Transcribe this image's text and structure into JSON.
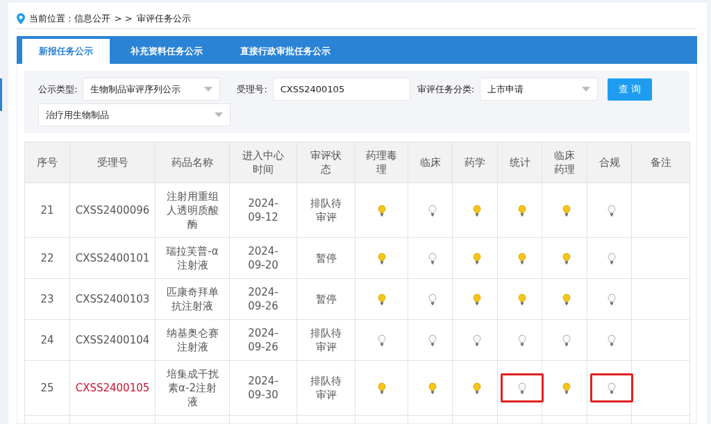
{
  "breadcrumb": {
    "label": "当前位置 : 信息公开",
    "separator": "> >",
    "current": "审评任务公示"
  },
  "tabs": [
    {
      "label": "新报任务公示",
      "selected": true
    },
    {
      "label": "补充资料任务公示",
      "selected": false
    },
    {
      "label": "直接行政审批任务公示",
      "selected": false
    }
  ],
  "filters": {
    "type_label": "公示类型:",
    "type_value": "生物制品审评序列公示",
    "subtype_value": "治疗用生物制品",
    "number_label": "受理号:",
    "number_value": "CXSS2400105",
    "category_label": "审评任务分类:",
    "category_value": "上市申请",
    "query_button": "查 询"
  },
  "table": {
    "columns": [
      "序号",
      "受理号",
      "药品名称",
      "进入中心时间",
      "审评状态",
      "药理毒理",
      "临床",
      "药学",
      "统计",
      "临床药理",
      "合规",
      "备注"
    ],
    "rows": [
      {
        "index": "21",
        "number": "CXSS2400096",
        "drug": "注射用重组人透明质酸酶",
        "date": "2024-09-12",
        "status": "排队待审评",
        "highlighted": false,
        "lamps": [
          {
            "lit": true,
            "highlighted": false
          },
          {
            "lit": false,
            "highlighted": false
          },
          {
            "lit": true,
            "highlighted": false
          },
          {
            "lit": true,
            "highlighted": false
          },
          {
            "lit": true,
            "highlighted": false
          },
          {
            "lit": false,
            "highlighted": false
          }
        ]
      },
      {
        "index": "22",
        "number": "CXSS2400101",
        "drug": "瑞拉芙普-α注射液",
        "date": "2024-09-20",
        "status": "暂停",
        "highlighted": false,
        "lamps": [
          {
            "lit": true,
            "highlighted": false
          },
          {
            "lit": false,
            "highlighted": false
          },
          {
            "lit": true,
            "highlighted": false
          },
          {
            "lit": true,
            "highlighted": false
          },
          {
            "lit": true,
            "highlighted": false
          },
          {
            "lit": false,
            "highlighted": false
          }
        ]
      },
      {
        "index": "23",
        "number": "CXSS2400103",
        "drug": "匹康奇拜单抗注射液",
        "date": "2024-09-26",
        "status": "暂停",
        "highlighted": false,
        "lamps": [
          {
            "lit": true,
            "highlighted": false
          },
          {
            "lit": false,
            "highlighted": false
          },
          {
            "lit": true,
            "highlighted": false
          },
          {
            "lit": true,
            "highlighted": false
          },
          {
            "lit": true,
            "highlighted": false
          },
          {
            "lit": false,
            "highlighted": false
          }
        ]
      },
      {
        "index": "24",
        "number": "CXSS2400104",
        "drug": "纳基奥仑赛注射液",
        "date": "2024-09-26",
        "status": "排队待审评",
        "highlighted": false,
        "lamps": [
          {
            "lit": false,
            "highlighted": false
          },
          {
            "lit": false,
            "highlighted": false
          },
          {
            "lit": false,
            "highlighted": false
          },
          {
            "lit": false,
            "highlighted": false
          },
          {
            "lit": false,
            "highlighted": false
          },
          {
            "lit": false,
            "highlighted": false
          }
        ]
      },
      {
        "index": "25",
        "number": "CXSS2400105",
        "drug": "培集成干扰素α-2注射液",
        "date": "2024-09-30",
        "status": "排队待审评",
        "highlighted": true,
        "lamps": [
          {
            "lit": true,
            "highlighted": false
          },
          {
            "lit": true,
            "highlighted": false
          },
          {
            "lit": true,
            "highlighted": false
          },
          {
            "lit": false,
            "highlighted": true
          },
          {
            "lit": true,
            "highlighted": false
          },
          {
            "lit": false,
            "highlighted": true
          }
        ]
      }
    ]
  }
}
